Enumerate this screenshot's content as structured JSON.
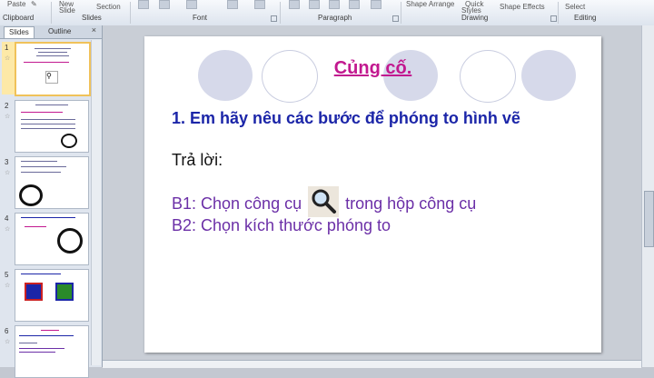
{
  "ribbon": {
    "paste": "Paste",
    "new_slide": "New",
    "slide_sub": "Slide",
    "section": "Section",
    "groups": {
      "clipboard": "Clipboard",
      "slides": "Slides",
      "font": "Font",
      "paragraph": "Paragraph",
      "drawing": "Drawing",
      "editing": "Editing"
    },
    "shape_arrange": "Shape Arrange",
    "quick": "Quick",
    "styles": "Styles",
    "shape_effects": "Shape Effects",
    "select": "Select"
  },
  "pane": {
    "tabs": [
      "Slides",
      "Outline"
    ],
    "close": "×",
    "slide_numbers": [
      "1",
      "2",
      "3",
      "4",
      "5",
      "6"
    ]
  },
  "slide": {
    "title": "Củng cố.",
    "question": "1. Em hãy nêu các bước để phóng to hình vẽ",
    "answer_label": "Trả lời:",
    "b1_pre": "B1: Chọn công cụ",
    "b1_post": "trong hộp công cụ",
    "b2": "B2: Chọn kích thước phóng to"
  },
  "colors": {
    "title": "#c2188f",
    "question": "#1b25a8",
    "steps": "#6b2fa7",
    "selected_thumb": "#fde9a7"
  },
  "icons": [
    "paste-icon",
    "magnifier-icon",
    "star-icon",
    "close-icon"
  ]
}
